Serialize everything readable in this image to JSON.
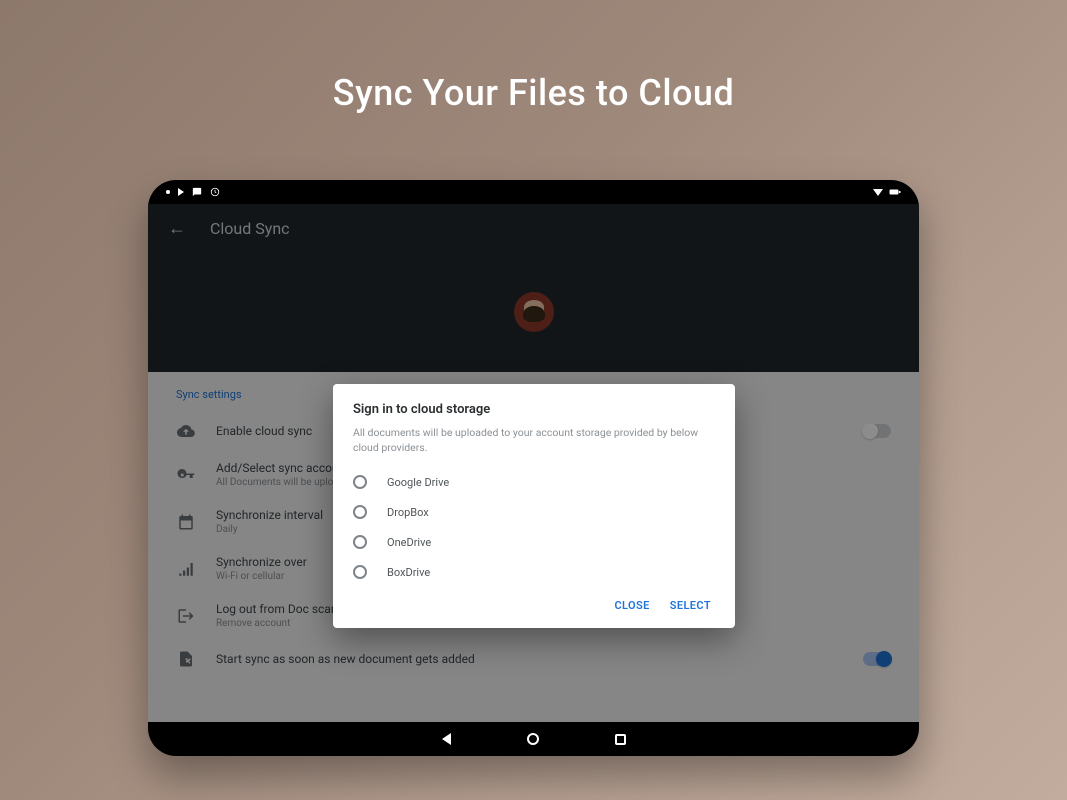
{
  "headline": "Sync Your Files to Cloud",
  "toolbar": {
    "title": "Cloud Sync"
  },
  "section_label": "Sync settings",
  "settings": [
    {
      "icon": "cloud-upload",
      "title": "Enable cloud sync",
      "subtitle": "",
      "toggle": "off"
    },
    {
      "icon": "key",
      "title": "Add/Select sync account",
      "subtitle": "All Documents will be uploaded to selected account"
    },
    {
      "icon": "calendar",
      "title": "Synchronize interval",
      "subtitle": "Daily"
    },
    {
      "icon": "signal",
      "title": "Synchronize over",
      "subtitle": "Wi-Fi or cellular"
    },
    {
      "icon": "logout",
      "title": "Log out from Doc scanner",
      "subtitle": "Remove account"
    },
    {
      "icon": "file-sync",
      "title": "Start sync as soon as new document gets added",
      "subtitle": "",
      "toggle": "on"
    }
  ],
  "dialog": {
    "title": "Sign in to cloud storage",
    "description": "All documents will be uploaded to your account storage provided by below cloud providers.",
    "options": [
      "Google Drive",
      "DropBox",
      "OneDrive",
      "BoxDrive"
    ],
    "close_label": "CLOSE",
    "select_label": "SELECT"
  }
}
